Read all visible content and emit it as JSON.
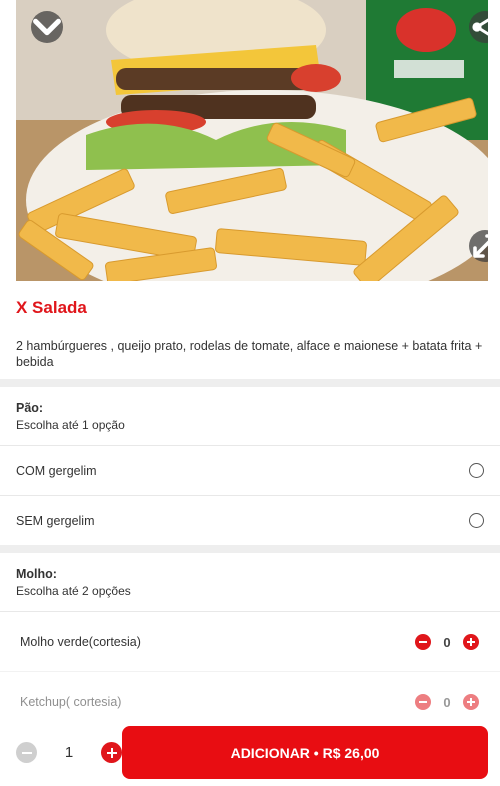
{
  "product": {
    "title": "X Salada",
    "description": "2 hambúrgueres , queijo prato, rodelas de tomate, alface e maionese + batata frita + bebida",
    "image_icons": [
      "chevron-down-icon",
      "share-icon",
      "expand-icon"
    ]
  },
  "groups": [
    {
      "name": "Pão:",
      "rule": "Escolha até 1 opção",
      "options": [
        {
          "label": "COM gergelim",
          "selected": false
        },
        {
          "label": "SEM gergelim",
          "selected": false
        }
      ]
    },
    {
      "name": "Molho:",
      "rule": "Escolha até 2 opções",
      "options": [
        {
          "label": "Molho verde(cortesia)",
          "quantity": "0"
        },
        {
          "label": "Ketchup( cortesia)",
          "quantity": "0"
        }
      ]
    }
  ],
  "footer": {
    "quantity": "1",
    "add_button_label": "ADICIONAR • R$ 26,00"
  },
  "colors": {
    "accent": "#e0161b",
    "disabled": "#cfcfcf",
    "divider": "#eeeeee"
  }
}
